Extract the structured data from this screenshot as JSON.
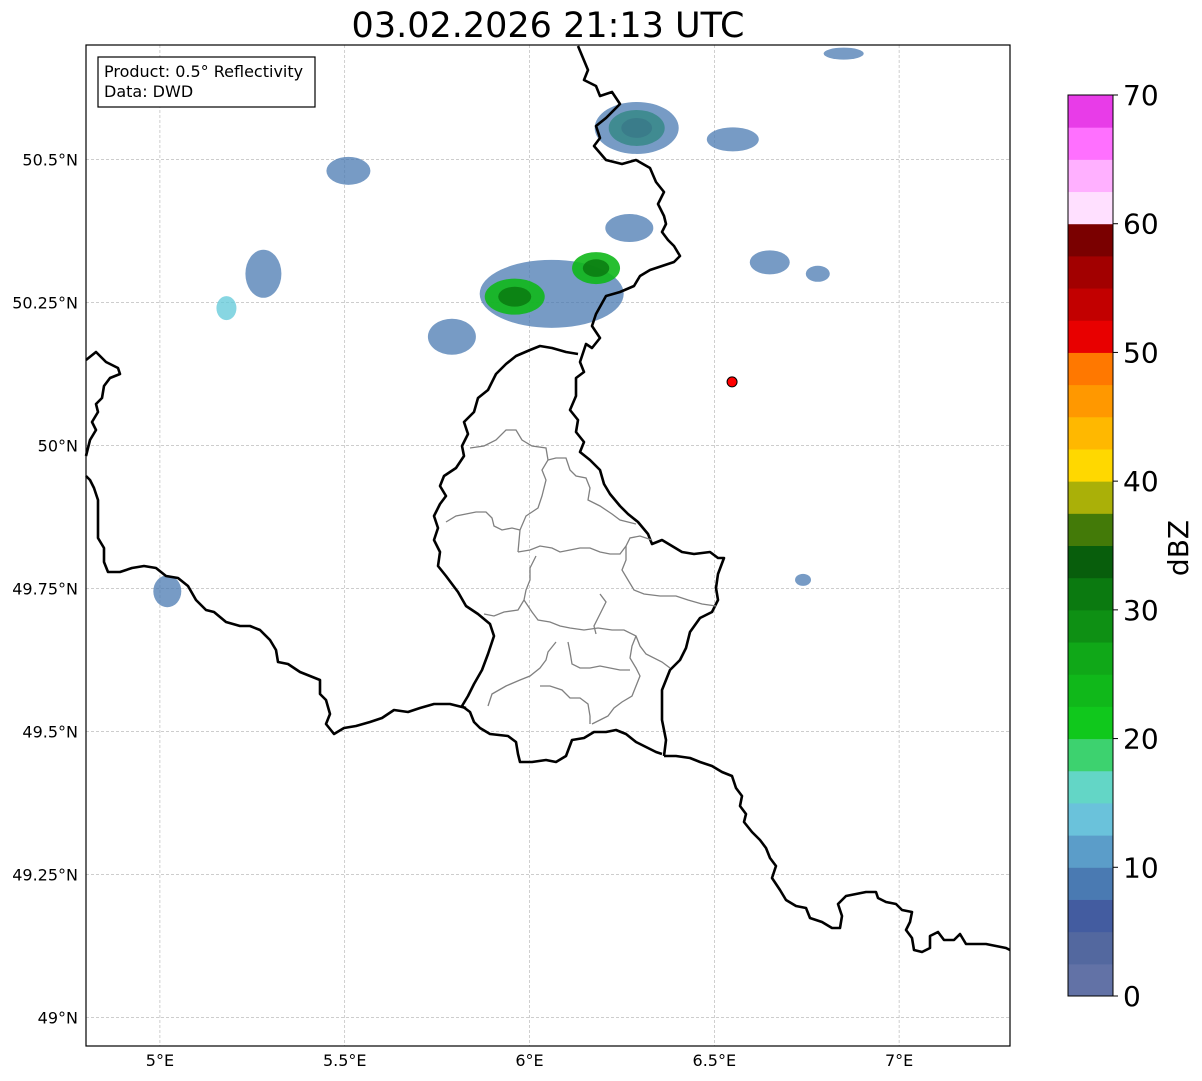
{
  "title": "03.02.2026 21:13 UTC",
  "info_box": {
    "product": "Product: 0.5° Reflectivity",
    "data": "Data: DWD"
  },
  "map": {
    "lon_range": [
      4.8,
      7.3
    ],
    "lat_range": [
      48.95,
      50.7
    ],
    "lon_ticks": [
      {
        "value": 5.0,
        "label": "5°E"
      },
      {
        "value": 5.5,
        "label": "5.5°E"
      },
      {
        "value": 6.0,
        "label": "6°E"
      },
      {
        "value": 6.5,
        "label": "6.5°E"
      },
      {
        "value": 7.0,
        "label": "7°E"
      }
    ],
    "lat_ticks": [
      {
        "value": 49.0,
        "label": "49°N"
      },
      {
        "value": 49.25,
        "label": "49.25°N"
      },
      {
        "value": 49.5,
        "label": "49.5°N"
      },
      {
        "value": 49.75,
        "label": "49.75°N"
      },
      {
        "value": 50.0,
        "label": "50°N"
      },
      {
        "value": 50.25,
        "label": "50.25°N"
      },
      {
        "value": 50.5,
        "label": "50.5°N"
      }
    ],
    "radar_site": {
      "lon": 6.548,
      "lat": 50.111,
      "color": "#ff0000"
    },
    "grid": true
  },
  "colorbar": {
    "label": "dBZ",
    "min": 0,
    "max": 70,
    "step": 2.5,
    "ticks": [
      {
        "value": 0,
        "label": "0"
      },
      {
        "value": 10,
        "label": "10"
      },
      {
        "value": 20,
        "label": "20"
      },
      {
        "value": 30,
        "label": "30"
      },
      {
        "value": 40,
        "label": "40"
      },
      {
        "value": 50,
        "label": "50"
      },
      {
        "value": 60,
        "label": "60"
      },
      {
        "value": 70,
        "label": "70"
      }
    ],
    "colors": [
      "#6272a6",
      "#53689f",
      "#435ca0",
      "#4a7ab2",
      "#5b9dc9",
      "#6ac2db",
      "#63d6c6",
      "#3dd26f",
      "#10c81c",
      "#10b81a",
      "#10a818",
      "#0e9014",
      "#0b7a10",
      "#085e0c",
      "#437a08",
      "#aab008",
      "#ffd800",
      "#ffb800",
      "#ff9800",
      "#ff7800",
      "#e80000",
      "#c20000",
      "#a20000",
      "#7a0000",
      "#ffe0ff",
      "#ffb0ff",
      "#ff70ff",
      "#e83ce8"
    ]
  },
  "echoes": [
    {
      "lon": 6.29,
      "lat": 50.555,
      "rx": 28,
      "ry": 18,
      "peak": "green"
    },
    {
      "lon": 6.29,
      "lat": 50.555,
      "rx": 42,
      "ry": 26,
      "peak": "blue"
    },
    {
      "lon": 6.06,
      "lat": 50.265,
      "rx": 72,
      "ry": 34,
      "peak": "blue"
    },
    {
      "lon": 5.96,
      "lat": 50.26,
      "rx": 30,
      "ry": 18,
      "peak": "green"
    },
    {
      "lon": 6.18,
      "lat": 50.31,
      "rx": 24,
      "ry": 16,
      "peak": "green"
    },
    {
      "lon": 5.79,
      "lat": 50.19,
      "rx": 24,
      "ry": 18,
      "peak": "blue"
    },
    {
      "lon": 6.27,
      "lat": 50.38,
      "rx": 24,
      "ry": 14,
      "peak": "blue"
    },
    {
      "lon": 5.28,
      "lat": 50.3,
      "rx": 18,
      "ry": 24,
      "peak": "blue"
    },
    {
      "lon": 5.18,
      "lat": 50.24,
      "rx": 10,
      "ry": 12,
      "peak": "cyan"
    },
    {
      "lon": 5.51,
      "lat": 50.48,
      "rx": 22,
      "ry": 14,
      "peak": "blue"
    },
    {
      "lon": 6.55,
      "lat": 50.535,
      "rx": 26,
      "ry": 12,
      "peak": "blue"
    },
    {
      "lon": 6.65,
      "lat": 50.32,
      "rx": 20,
      "ry": 12,
      "peak": "blue"
    },
    {
      "lon": 6.78,
      "lat": 50.3,
      "rx": 12,
      "ry": 8,
      "peak": "blue"
    },
    {
      "lon": 6.85,
      "lat": 50.685,
      "rx": 20,
      "ry": 6,
      "peak": "blue"
    },
    {
      "lon": 5.02,
      "lat": 49.745,
      "rx": 14,
      "ry": 16,
      "peak": "blue"
    },
    {
      "lon": 6.74,
      "lat": 49.765,
      "rx": 8,
      "ry": 6,
      "peak": "blue"
    }
  ]
}
